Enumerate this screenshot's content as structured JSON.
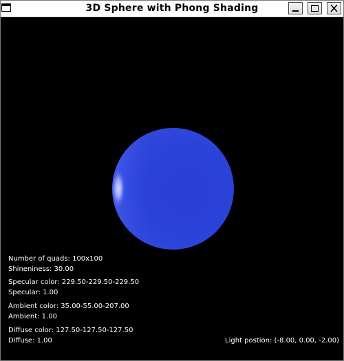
{
  "window": {
    "title": "3D Sphere with Phong Shading",
    "buttons": {
      "minimize": "minimize",
      "maximize": "maximize",
      "close": "close"
    }
  },
  "sphere": {
    "base_color": "#2b42d8",
    "highlight_color": "#ffffff"
  },
  "info": {
    "quads": "Number of quads: 100x100",
    "shininess": "Shineniness: 30.00",
    "specular_color": "Specular color: 229.50-229.50-229.50",
    "specular": "Specular: 1.00",
    "ambient_color": "Ambient color: 35.00-55.00-207.00",
    "ambient": "Ambient: 1.00",
    "diffuse_color": "Diffuse color: 127.50-127.50-127.50",
    "diffuse": "Diffuse: 1.00",
    "light_position": "Light postion: (-8.00, 0.00, -2.00)"
  }
}
